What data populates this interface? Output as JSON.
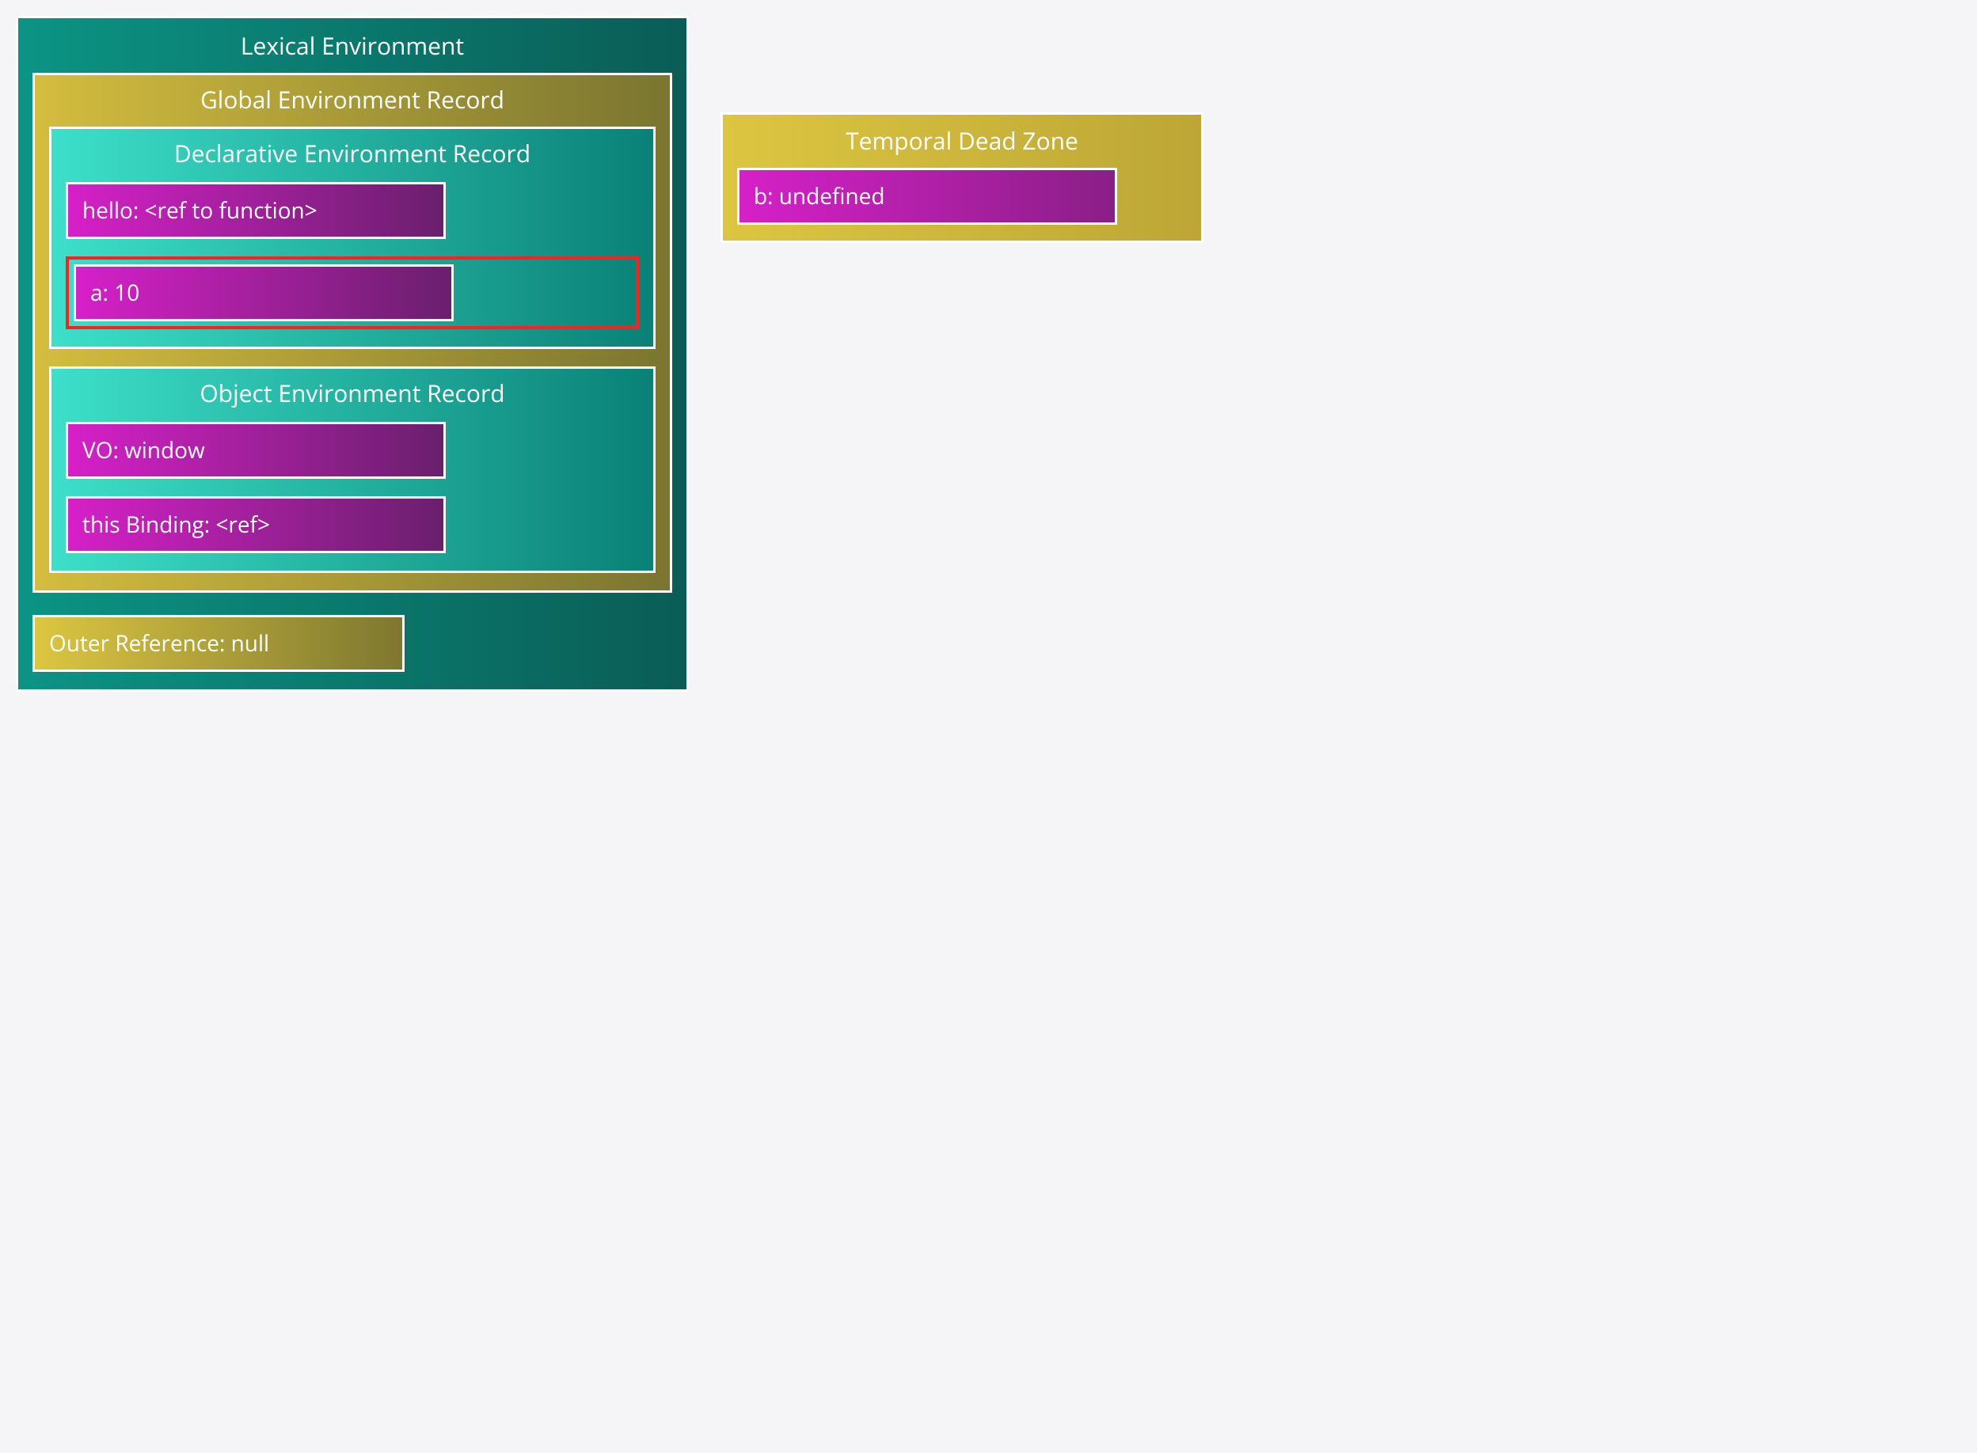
{
  "lexicalEnv": {
    "title": "Lexical Environment",
    "globalEnvRecord": {
      "title": "Global Environment Record",
      "declarativeRecord": {
        "title": "Declarative Environment Record",
        "bindings": [
          {
            "text": "hello: <ref to function>",
            "highlighted": false
          },
          {
            "text": "a: 10",
            "highlighted": true
          }
        ]
      },
      "objectRecord": {
        "title": "Object Environment Record",
        "bindings": [
          {
            "text": "VO: window",
            "highlighted": false
          },
          {
            "text": "this Binding: <ref>",
            "highlighted": false
          }
        ]
      }
    },
    "outerReference": "Outer Reference: null"
  },
  "tdz": {
    "title": "Temporal Dead Zone",
    "binding": "b: undefined"
  }
}
